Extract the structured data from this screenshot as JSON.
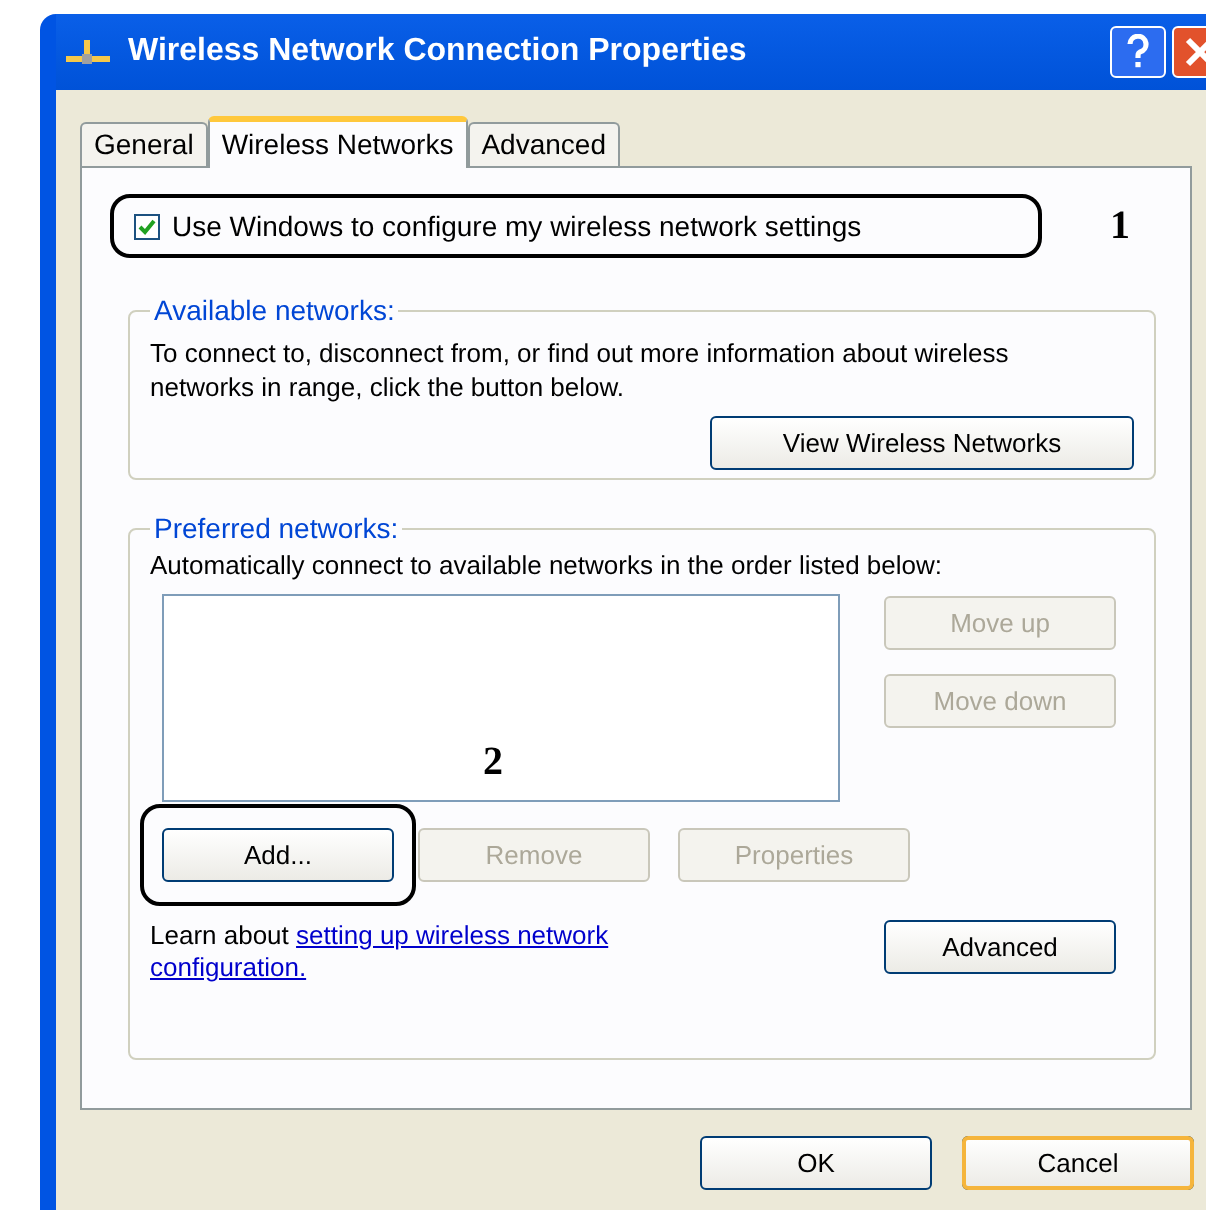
{
  "window": {
    "title": "Wireless Network Connection Properties"
  },
  "tabs": [
    {
      "label": "General",
      "selected": false
    },
    {
      "label": "Wireless Networks",
      "selected": true
    },
    {
      "label": "Advanced",
      "selected": false
    }
  ],
  "use_windows": {
    "label": "Use Windows to configure my wireless network settings",
    "checked": true
  },
  "callouts": [
    "1",
    "2"
  ],
  "available": {
    "legend": "Available networks:",
    "text": "To connect to, disconnect from, or find out more information about wireless networks in range, click the button below.",
    "button": "View Wireless Networks"
  },
  "preferred": {
    "legend": "Preferred networks:",
    "text": "Automatically connect to available networks in the order listed below:",
    "side_buttons": [
      {
        "label": "Move up",
        "disabled": true
      },
      {
        "label": "Move down",
        "disabled": true
      }
    ],
    "row_buttons": [
      {
        "label": "Add...",
        "disabled": false
      },
      {
        "label": "Remove",
        "disabled": true
      },
      {
        "label": "Properties",
        "disabled": true
      }
    ],
    "learn": {
      "text": "Learn about",
      "link": [
        "setting up wireless network",
        "configuration."
      ]
    },
    "advanced_button": "Advanced"
  },
  "footer_buttons": [
    {
      "label": "OK",
      "default": false
    },
    {
      "label": "Cancel",
      "default": true
    }
  ]
}
